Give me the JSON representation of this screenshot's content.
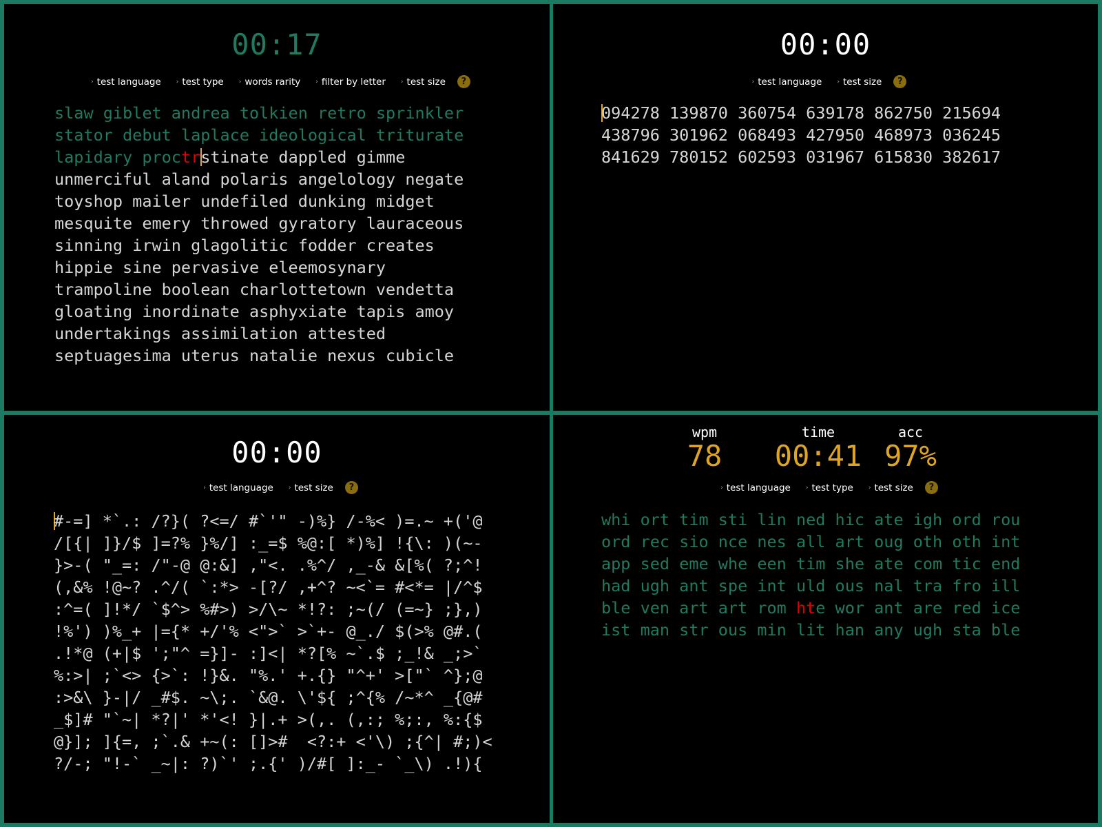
{
  "panel_words": {
    "timer": "00:17",
    "menu": [
      "test language",
      "test type",
      "words rarity",
      "filter by letter",
      "test size"
    ],
    "help_label": "?",
    "text": {
      "typed": "slaw giblet andrea tolkien retro sprinkler\nstator debut laplace ideological triturate\nlapidary proc",
      "error": "tr",
      "remaining": "stinate dappled gimme\nunmerciful aland polaris angelology negate\ntoyshop mailer undefiled dunking midget\nmesquite emery throwed gyratory lauraceous\nsinning irwin glagolitic fodder creates\nhippie sine pervasive eleemosynary\ntrampoline boolean charlottetown vendetta\ngloating inordinate asphyxiate tapis amoy\nundertakings assimilation attested\nseptuagesima uterus natalie nexus cubicle"
    }
  },
  "panel_numbers": {
    "timer": "00:00",
    "menu": [
      "test language",
      "test size"
    ],
    "help_label": "?",
    "text": "094278 139870 360754 639178 862750 215694\n438796 301962 068493 427950 468973 036245\n841629 780152 602593 031967 615830 382617"
  },
  "panel_symbols": {
    "timer": "00:00",
    "menu": [
      "test language",
      "test size"
    ],
    "help_label": "?",
    "text": "#-=] *`.: /?}( ?<=/ #`'\" -)%} /-%< )=.~ +('@\n/[{| ]}/$ ]=?% }%/] :_=$ %@:[ *)%] !{\\: )(~-\n}>-( \"_=: /\"-@ @:&] ,\"<. .%^/ ,_-& &[%( ?;^!\n(,&% !@~? .^/( `:*> -[?/ ,+^? ~<`= #<*= |/^$\n:^=( ]!*/ `$^> %#>) >/\\~ *!?: ;~(/ (=~} ;},)\n!%') )%_+ |={* +/'% <\">` >`+- @_./ $(>% @#.(\n.!*@ (+|$ ';\"^ =}]- :]<| *?[% ~`.$ ;_!& _;>`\n%:>| ;`<> {>`: !}&. \"%.' +.{} \"^+' >[\"` ^};@\n:>&\\ }-|/ _#$. ~\\;. `&@. \\'${ ;^{% /~*^ _{@#\n_$]# \"`~| *?|' *'<! }|.+ >(,. (,:; %;:, %:{$\n@}]; ]{=, ;`.& +~(: []>#  <?:+ <'\\) ;{^| #;)<\n?/-; \"!-` _~|: ?)`' ;.{' )/#[ ]:_- `_\\) .!){"
  },
  "panel_results": {
    "stats": {
      "wpm_label": "wpm",
      "wpm": "78",
      "time_label": "time",
      "time": "00:41",
      "acc_label": "acc",
      "acc": "97%"
    },
    "menu": [
      "test language",
      "test type",
      "test size"
    ],
    "help_label": "?",
    "text": {
      "before": "whi ort tim sti lin ned hic ate igh ord rou\nord rec sio nce nes all art oug oth oth int\napp sed eme whe een tim she ate com tic end\nhad ugh ant spe int uld ous nal tra fro ill\nble ven art art rom ",
      "error": "ht",
      "after": "e wor ant are red ice\nist man str ous min lit han any ugh sta ble"
    }
  },
  "colors": {
    "border": "#1a7a62",
    "typed": "#1f7a5f",
    "error": "#e00000",
    "caret": "#e0a72a",
    "stat_value": "#e0a520",
    "help_bg": "#8a6d0c"
  }
}
